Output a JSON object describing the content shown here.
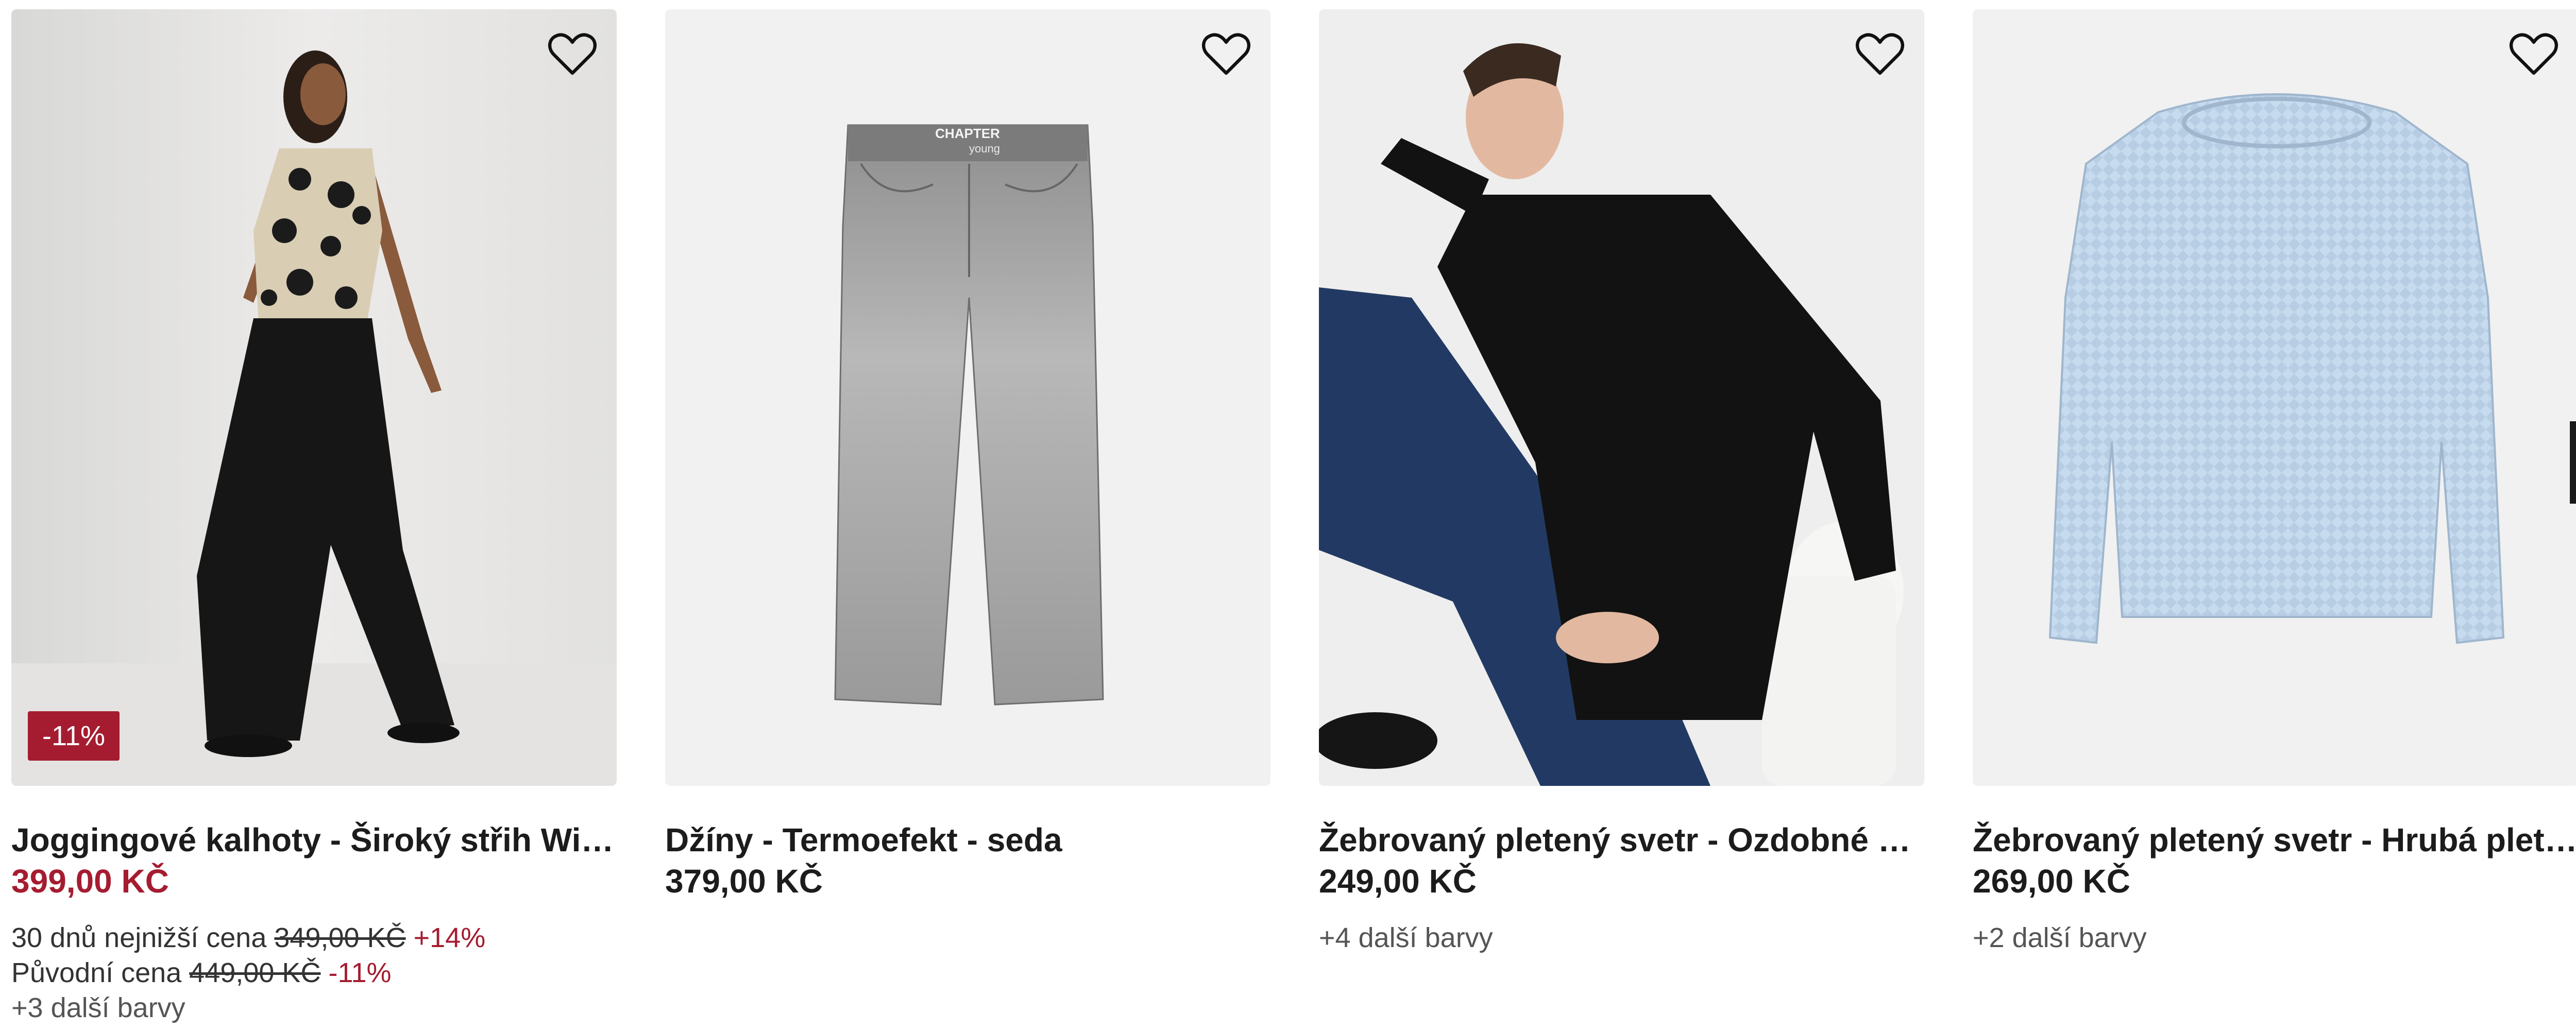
{
  "products": [
    {
      "title": "Joggingové kalhoty - Široký střih Wide…",
      "price": "399,00 KČ",
      "badge": "-11%",
      "lowest_label": "30 dnů nejnižší cena",
      "lowest_price": "349,00 KČ",
      "lowest_change": "+14%",
      "original_label": "Původní cena",
      "original_price": "449,00 KČ",
      "original_change": "-11%",
      "more_colors": "+3 další barvy",
      "image_icon": "woman-wide-leg-trousers-photo"
    },
    {
      "title": "Džíny - Termoefekt - seda",
      "price": "379,00 KČ",
      "image_brand_text": "CHAPTER",
      "image_brand_sub": "young",
      "image_icon": "grey-jeans-photo"
    },
    {
      "title": "Žebrovaný pletený svetr - Ozdobné kn…",
      "price": "249,00 KČ",
      "more_colors": "+4 další barvy",
      "image_icon": "woman-black-sweater-photo"
    },
    {
      "title": "Žebrovaný pletený svetr - Hrubá plete…",
      "price": "269,00 KČ",
      "more_colors": "+2 další barvy",
      "image_icon": "light-blue-knit-sweater-photo"
    }
  ],
  "icons": {
    "favorite": "heart-outline-icon"
  },
  "colors": {
    "sale": "#a51c30",
    "text": "#1c1c1c",
    "image_bg": "#f1f1f1"
  }
}
